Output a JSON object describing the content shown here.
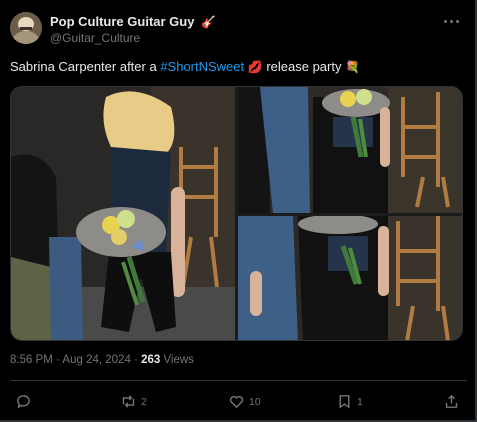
{
  "author": {
    "display_name": "Pop Culture Guitar Guy",
    "name_emoji": "🎸",
    "handle": "@Guitar_Culture"
  },
  "tweet": {
    "text_before": "Sabrina Carpenter after a ",
    "hashtag": "#ShortNSweet",
    "emoji_lips": "💋",
    "text_after": " release party ",
    "emoji_bouquet": "💐"
  },
  "meta": {
    "time": "8:56 PM",
    "separator": " · ",
    "date": "Aug 24, 2024",
    "views_count": "263",
    "views_label": "Views"
  },
  "actions": {
    "replies": "",
    "retweets": "2",
    "likes": "10",
    "bookmarks": "1"
  },
  "colors": {
    "background": "#000000",
    "text": "#e7e9ea",
    "muted": "#71767b",
    "link": "#1d9bf0",
    "divider": "#2f3336"
  },
  "icons": [
    "more-options-icon",
    "reply-icon",
    "retweet-icon",
    "like-icon",
    "bookmark-icon",
    "share-icon"
  ]
}
